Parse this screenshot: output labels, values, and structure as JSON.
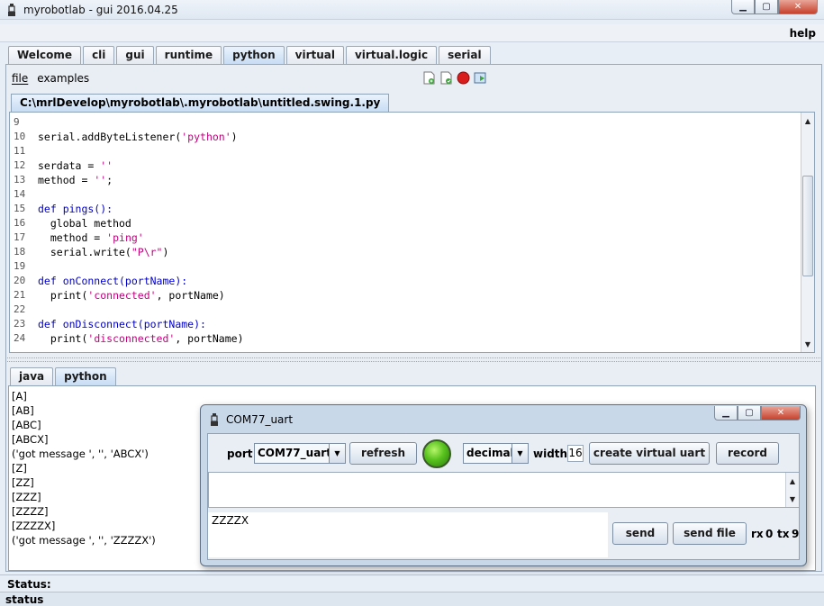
{
  "window": {
    "title": "myrobotlab - gui 2016.04.25",
    "minimize": "▁",
    "maximize": "▢",
    "close": "✕"
  },
  "menu": {
    "help": "help"
  },
  "main_tabs": [
    "Welcome",
    "cli",
    "gui",
    "runtime",
    "python",
    "virtual",
    "virtual.logic",
    "serial"
  ],
  "python": {
    "menu": [
      "file",
      "examples"
    ],
    "toolbar_icons": [
      "new-script-icon",
      "open-script-icon",
      "stop-record-icon",
      "execute-icon"
    ],
    "file_tab": "C:\\mrlDevelop\\myrobotlab\\.myrobotlab\\untitled.swing.1.py",
    "code_lines": [
      {
        "n": "9",
        "t": ""
      },
      {
        "n": "10",
        "t": "serial.addByteListener('python')"
      },
      {
        "n": "11",
        "t": ""
      },
      {
        "n": "12",
        "t": "serdata = ''"
      },
      {
        "n": "13",
        "t": "method = '';"
      },
      {
        "n": "14",
        "t": ""
      },
      {
        "n": "15",
        "t": "def pings():"
      },
      {
        "n": "16",
        "t": "  global method"
      },
      {
        "n": "17",
        "t": "  method = 'ping'"
      },
      {
        "n": "18",
        "t": "  serial.write(\"P\\r\")"
      },
      {
        "n": "19",
        "t": ""
      },
      {
        "n": "20",
        "t": "def onConnect(portName):"
      },
      {
        "n": "21",
        "t": "  print('connected', portName)"
      },
      {
        "n": "22",
        "t": ""
      },
      {
        "n": "23",
        "t": "def onDisconnect(portName):"
      },
      {
        "n": "24",
        "t": "  print('disconnected', portName)"
      }
    ],
    "lower_tabs": [
      "java",
      "python"
    ],
    "console_lines": [
      "[A]",
      "[AB]",
      "[ABC]",
      "[ABCX]",
      "('got message ', '', 'ABCX')",
      "[Z]",
      "[ZZ]",
      "[ZZZ]",
      "[ZZZZ]",
      "[ZZZZX]",
      "('got message ', '', 'ZZZZX')"
    ]
  },
  "status": {
    "label": "Status:",
    "bar": "status"
  },
  "dialog": {
    "title": "COM77_uart",
    "port_label": "port",
    "port_value": "COM77_uart",
    "refresh": "refresh",
    "format_value": "decimal",
    "width_label": "width",
    "width_value": "16",
    "create_virtual_uart": "create virtual uart",
    "record": "record",
    "send_text": "ZZZZX",
    "send": "send",
    "send_file": "send file",
    "rx_label": "rx",
    "rx_value": "0",
    "tx_label": "tx",
    "tx_value": "9"
  }
}
